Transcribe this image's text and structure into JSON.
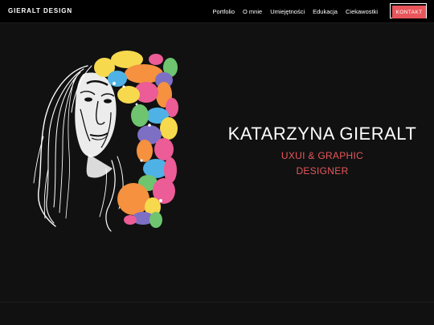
{
  "header": {
    "brand": "GIERALT DESIGN",
    "nav": [
      {
        "label": "Portfolio"
      },
      {
        "label": "O mnie"
      },
      {
        "label": "Umiejętności"
      },
      {
        "label": "Edukacja"
      },
      {
        "label": "Ciekawostki"
      }
    ],
    "cta": "KONTAKT"
  },
  "hero": {
    "name": "KATARZYNA GIERALT",
    "role_line1": "UXUI & GRAPHIC",
    "role_line2": "DESIGNER"
  },
  "colors": {
    "background": "#111111",
    "topbar": "#000000",
    "accent": "#e8565b",
    "text": "#ffffff"
  }
}
